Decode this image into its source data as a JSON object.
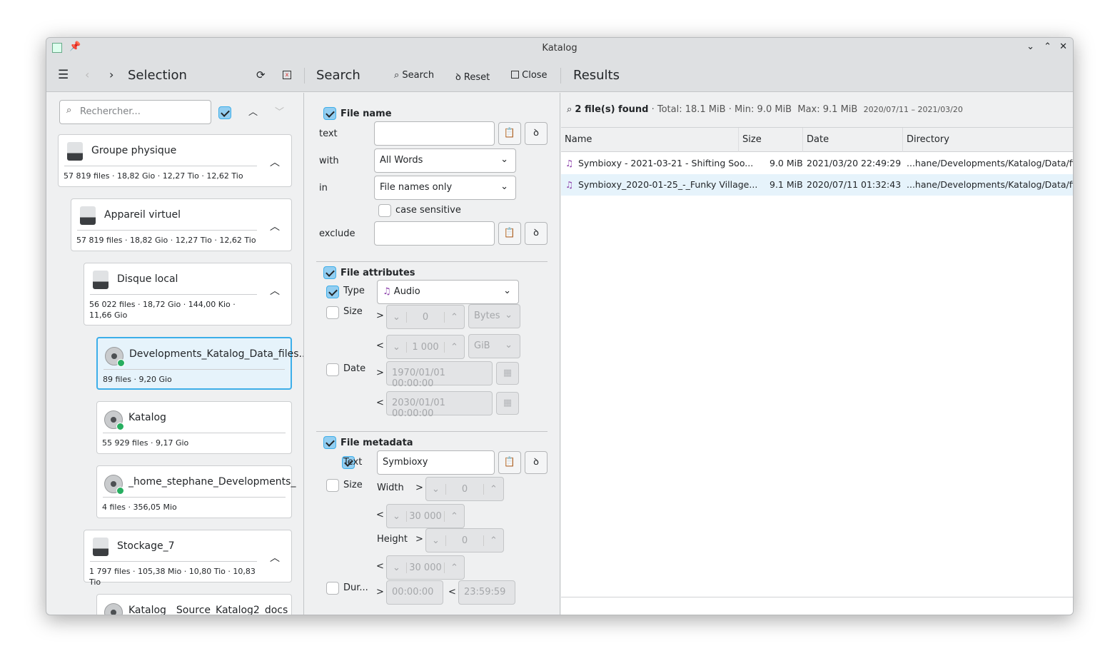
{
  "window": {
    "title": "Katalog"
  },
  "toolbar": {
    "selection_title": "Selection",
    "search_title": "Search",
    "search_btn": "Search",
    "reset_btn": "Reset",
    "close_btn": "Close",
    "results_title": "Results"
  },
  "selection": {
    "search_placeholder": "Rechercher...",
    "cards": [
      {
        "name": "Groupe physique",
        "info": "57 819 files · 18,82 Gio  · 12,27 Tio · 12,62 Tio"
      },
      {
        "name": "Appareil virtuel",
        "info": "57 819 files · 18,82 Gio  · 12,27 Tio · 12,62 Tio"
      },
      {
        "name": "Disque local",
        "info": "56 022 files · 18,72 Gio  · 144,00 Kio · 11,66 Gio"
      },
      {
        "name": "Developments_Katalog_Data_files...",
        "info": "89 files · 9,20 Gio",
        "selected": true
      },
      {
        "name": "Katalog",
        "info": "55 929 files · 9,17 Gio"
      },
      {
        "name": "_home_stephane_Developments_",
        "info": "4 files · 356,05 Mio"
      },
      {
        "name": "Stockage_7",
        "info": "1 797 files · 105,38 Mio · 10,80 Tio · 10,83 Tio"
      },
      {
        "name": "Katalog__Source_Katalog2_docs",
        "info": ""
      }
    ]
  },
  "search": {
    "file_name": {
      "label": "File name",
      "checked": true,
      "text_label": "text",
      "text_value": "",
      "with_label": "with",
      "with_value": "All Words",
      "in_label": "in",
      "in_value": "File names only",
      "case_label": "case sensitive",
      "case_checked": false,
      "exclude_label": "exclude",
      "exclude_value": ""
    },
    "file_attributes": {
      "label": "File attributes",
      "checked": true,
      "type_label": "Type",
      "type_checked": true,
      "type_value": "Audio",
      "size_label": "Size",
      "size_checked": false,
      "size_min": "0",
      "size_min_unit": "Bytes",
      "size_max": "1 000",
      "size_max_unit": "GiB",
      "date_label": "Date",
      "date_checked": false,
      "date_min": "1970/01/01 00:00:00",
      "date_max": "2030/01/01 00:00:00",
      "gt": ">",
      "lt": "<"
    },
    "file_metadata": {
      "label": "File metadata",
      "checked": true,
      "text_label": "Text",
      "text_checked": true,
      "text_value": "Symbioxy",
      "size_label": "Size",
      "size_checked": false,
      "width_label": "Width",
      "width_min": "0",
      "width_max": "30 000",
      "height_label": "Height",
      "height_min": "0",
      "height_max": "30 000",
      "dur_label": "Dur...",
      "dur_checked": false,
      "dur_min": "00:00:00",
      "dur_max": "23:59:59"
    }
  },
  "results": {
    "found": "2 file(s) found",
    "total": "· Total: 18.1 MiB ·",
    "min": "Min: 9.0 MiB",
    "max": "Max: 9.1 MiB",
    "range": "2020/07/11 – 2021/03/20",
    "columns": [
      "Name",
      "Size",
      "Date",
      "Directory"
    ],
    "rows": [
      {
        "name": "Symbioxy - 2021-03-21 - Shifting Soo...",
        "size": "9.0 MiB",
        "date": "2021/03/20 22:49:29",
        "dir": "...hane/Developments/Katalog/Data/files_"
      },
      {
        "name": "Symbioxy_2020-01-25_-_Funky Village...",
        "size": "9.1 MiB",
        "date": "2020/07/11 01:32:43",
        "dir": "...hane/Developments/Katalog/Data/files_"
      }
    ]
  },
  "colors": {
    "accent": "#3daee9",
    "selected_row": "#e6f3fb",
    "audio_icon": "#8e44ad",
    "ok_badge": "#27ae60"
  }
}
